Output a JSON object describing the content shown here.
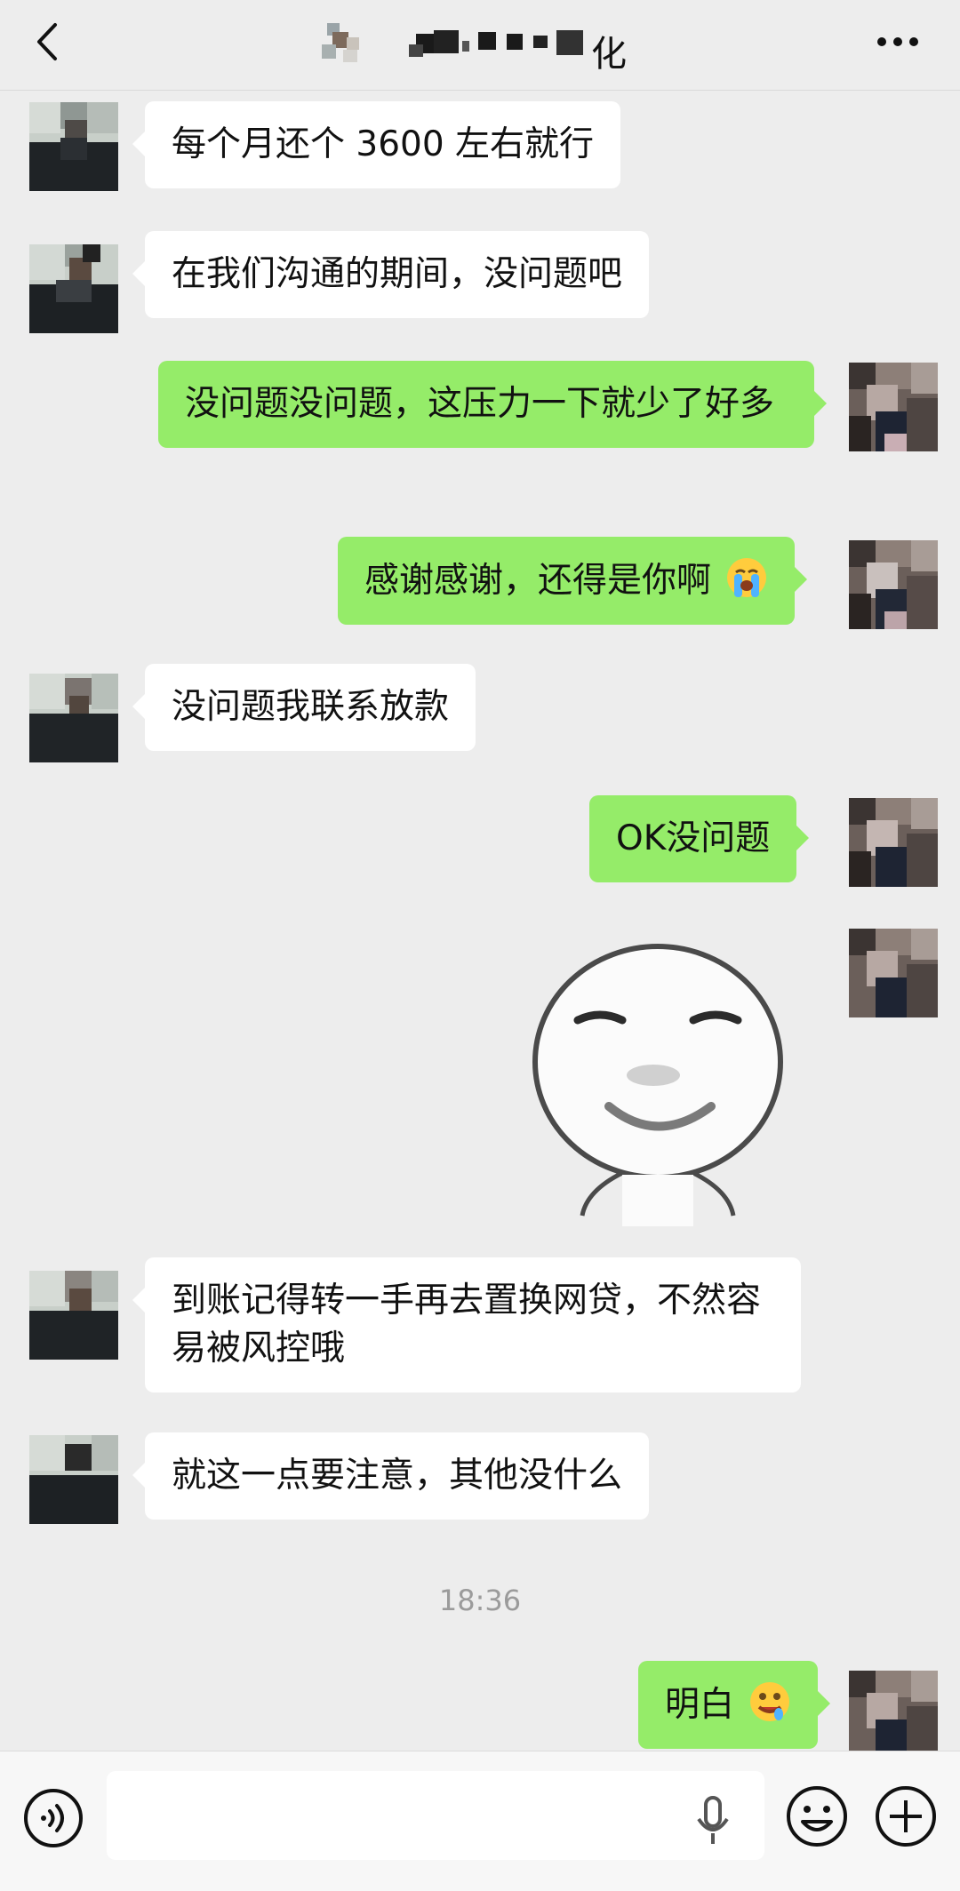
{
  "header": {
    "title": "化"
  },
  "messages": [
    {
      "side": "in",
      "text": "每个月还个 3600 左右就行"
    },
    {
      "side": "in",
      "text": "在我们沟通的期间，没问题吧"
    },
    {
      "side": "out",
      "text": "没问题没问题，这压力一下就少了好多"
    },
    {
      "side": "out",
      "text": "感谢感谢，还得是你啊"
    },
    {
      "side": "in",
      "text": "没问题我联系放款"
    },
    {
      "side": "out",
      "text": "OK没问题"
    },
    {
      "side": "in",
      "text": "到账记得转一手再去置换网贷，不然容易被风控哦"
    },
    {
      "side": "in",
      "text": "就这一点要注意，其他没什么"
    },
    {
      "side": "out",
      "text": "明白"
    }
  ],
  "timestamp": "18:36",
  "input": {
    "placeholder": ""
  },
  "colors": {
    "background": "#ededed",
    "outgoing_bubble": "#95ec69",
    "incoming_bubble": "#ffffff",
    "timestamp": "#9b9b9b"
  },
  "icons": {
    "back": "chevron-left-icon",
    "more": "ellipsis-icon",
    "voice": "voice-icon",
    "mic": "microphone-icon",
    "emoji": "smiley-icon",
    "plus": "plus-icon",
    "crying_emoji": "crying-face-emoji",
    "drooling_emoji": "drooling-face-emoji"
  }
}
